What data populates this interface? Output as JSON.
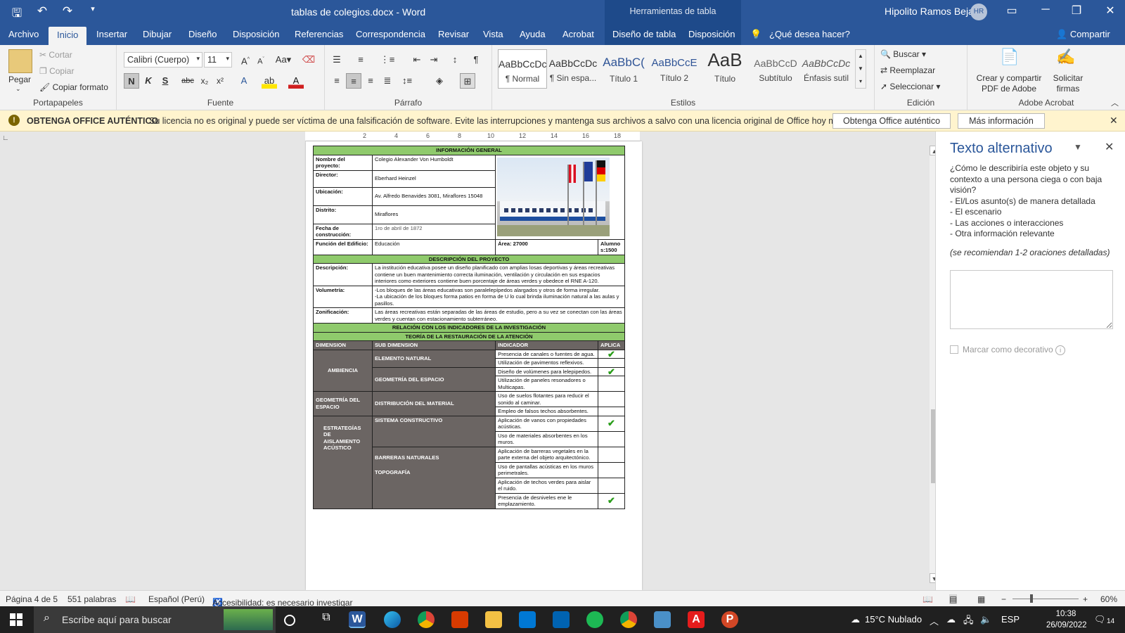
{
  "titlebar": {
    "doc_title": "tablas de colegios.docx  -  Word",
    "tools_title": "Herramientas de tabla",
    "user": "Hipolito Ramos Bejar",
    "avatar": "HR"
  },
  "tabs": [
    "Archivo",
    "Inicio",
    "Insertar",
    "Dibujar",
    "Diseño",
    "Disposición",
    "Referencias",
    "Correspondencia",
    "Revisar",
    "Vista",
    "Ayuda",
    "Acrobat",
    "Diseño de tabla",
    "Disposición"
  ],
  "tell_me": "¿Qué desea hacer?",
  "share": "Compartir",
  "ribbon": {
    "clipboard": {
      "paste": "Pegar",
      "cut": "Cortar",
      "copy": "Copiar",
      "format": "Copiar formato",
      "label": "Portapapeles"
    },
    "font": {
      "name": "Calibri (Cuerpo)",
      "size": "11",
      "label": "Fuente"
    },
    "paragraph": {
      "label": "Párrafo"
    },
    "styles": {
      "label": "Estilos",
      "items": [
        {
          "sample": "AaBbCcDc",
          "name": "¶ Normal"
        },
        {
          "sample": "AaBbCcDc",
          "name": "¶ Sin espa..."
        },
        {
          "sample": "AaBbC(",
          "name": "Título 1"
        },
        {
          "sample": "AaBbCcE",
          "name": "Título 2"
        },
        {
          "sample": "AaB",
          "name": "Título"
        },
        {
          "sample": "AaBbCcD",
          "name": "Subtítulo"
        },
        {
          "sample": "AaBbCcDc",
          "name": "Énfasis sutil"
        }
      ]
    },
    "editing": {
      "find": "Buscar",
      "replace": "Reemplazar",
      "select": "Seleccionar",
      "label": "Edición"
    },
    "acrobat": {
      "create": "Crear y compartir",
      "create2": "PDF de Adobe",
      "sign": "Solicitar",
      "sign2": "firmas",
      "label": "Adobe Acrobat"
    }
  },
  "license": {
    "title": "OBTENGA OFFICE AUTÉNTICO",
    "message": "Su licencia no es original y puede ser víctima de una falsificación de software. Evite las interrupciones y mantenga sus archivos a salvo con una licencia original de Office hoy mismo.",
    "btn1": "Obtenga Office auténtico",
    "btn2": "Más información"
  },
  "ruler": [
    "2",
    "4",
    "6",
    "8",
    "10",
    "12",
    "14",
    "16",
    "18"
  ],
  "doc": {
    "info_header": "INFORMACIÓN GENERAL",
    "rows": [
      {
        "label": "Nombre del proyecto:",
        "value": "Colegio Alexander Von Humboldt"
      },
      {
        "label": "Director:",
        "value": "Eberhard Heinzel"
      },
      {
        "label": "Ubicación:",
        "value": "Av. Alfredo Benavides 3081, Miraflores 15048"
      },
      {
        "label": "Distrito:",
        "value": "Miraflores"
      },
      {
        "label": "Fecha de construcción:",
        "value": "1ro de abril de 1872"
      }
    ],
    "function_label": "Función del Edificio:",
    "function_value": "Educación",
    "area": "Área: 27000",
    "students": "Alumno s:1500",
    "desc_header": "DESCRIPCIÓN DEL PROYECTO",
    "desc_label": "Descripción:",
    "desc_value": "La institución educativa posee un diseño planificado con amplias losas deportivas y áreas recreativas contiene un buen mantenimiento correcta iluminación, ventilación y circulación en sus espacios interiores como exteriores contiene buen porcentaje de áreas verdes y obedece el RNE A-120.",
    "vol_label": "Volumetría:",
    "vol_value1": "-Los bloques de las áreas educativas son paralelepípedos alargados y otros de forma irregular.",
    "vol_value2": "-La ubicación de los bloques forma patios en forma de U lo cual brinda iluminación natural a las aulas y pasillos.",
    "zon_label": "Zonificación:",
    "zon_value": "Las áreas recreativas están separadas de las áreas de estudio, pero a su vez se conectan con las áreas verdes y cuentan con estacionamiento subterráneo.",
    "rel_header": "RELACIÓN CON LOS INDICADORES DE LA INVESTIGACIÓN",
    "theory_header": "TEORÍA DE LA RESTAURACIÓN DE LA ATENCIÓN",
    "cols": [
      "DIMENSION",
      "SUB DIMENSION",
      "INDICADOR",
      "APLICA"
    ],
    "dims": [
      "AMBIENCIA",
      "GEOMETRÍA DEL ESPACIO",
      "ESTRATEGÍAS DE AISLAMIENTO ACÚSTICO"
    ],
    "subdims": [
      "ELEMENTO NATURAL",
      "GEOMETRÍA DEL ESPACIO",
      "DISTRIBUCIÓN DEL MATERIAL",
      "SISTEMA CONSTRUCTIVO",
      "BARRERAS NATURALES",
      "TOPOGRAFÍA"
    ],
    "indicators": [
      {
        "text": "Presencia de canales o fuentes de agua.",
        "check": "✔"
      },
      {
        "text": "Utilización de pavimentos reflexivos.",
        "check": ""
      },
      {
        "text": "Diseño de volúmenes para lelepipedos.",
        "check": "✔"
      },
      {
        "text": "Utilización de paneles resonadores o Multicapas.",
        "check": ""
      },
      {
        "text": "Uso de suelos flotantes para reducir el sonido al caminar.",
        "check": ""
      },
      {
        "text": "Empleo de falsos techos absorbentes.",
        "check": ""
      },
      {
        "text": "Aplicación de vanos con propiedades acústicas.",
        "check": "✔"
      },
      {
        "text": "Uso de materiales absorbentes en los muros.",
        "check": ""
      },
      {
        "text": "Aplicación de barreras vegetales en la parte externa del objeto arquitectónico.",
        "check": ""
      },
      {
        "text": "Uso de pantallas acústicas en los muros perimetrales.",
        "check": ""
      },
      {
        "text": "Aplicación de techos verdes para aislar el ruido.",
        "check": ""
      },
      {
        "text": "Presencia de desniveles ene le emplazamiento.",
        "check": "✔"
      }
    ]
  },
  "pane": {
    "title": "Texto alternativo",
    "question": "¿Cómo le describiría este objeto y su contexto a una persona ciega o con baja visión?",
    "bullets": [
      "- El/Los asunto(s) de manera detallada",
      "- El escenario",
      "- Las acciones o interacciones",
      "- Otra información relevante"
    ],
    "hint": "(se recomiendan 1-2 oraciones detalladas)",
    "decorative": "Marcar como decorativo"
  },
  "status": {
    "page": "Página 4 de 5",
    "words": "551 palabras",
    "lang": "Español (Perú)",
    "access": "Accesibilidad: es necesario investigar",
    "zoom": "60%"
  },
  "taskbar": {
    "search": "Escribe aquí para buscar",
    "weather": "15°C  Nublado",
    "lang": "ESP",
    "time": "10:38",
    "date": "26/09/2022",
    "notif": "14"
  },
  "colors": {
    "word_blue": "#2b579a",
    "header_green": "#8fca6c",
    "grey_cell": "#6b6563",
    "license_bg": "#fff4ce"
  }
}
